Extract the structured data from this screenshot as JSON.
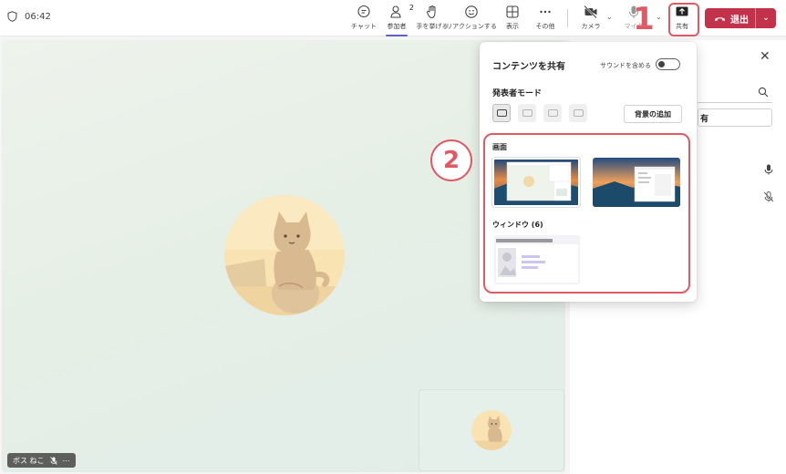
{
  "header": {
    "timer": "06:42",
    "buttons": {
      "chat": "チャット",
      "people": "参加者",
      "people_count": "2",
      "raise_hand": "手を挙げる",
      "reactions": "リアクションする",
      "view": "表示",
      "more": "その他",
      "camera": "カメラ",
      "mic": "マイク",
      "share": "共有"
    },
    "leave": "退出"
  },
  "annotations": {
    "step1": "1",
    "step2": "2",
    "color": "#e05a66"
  },
  "stage": {
    "participant_name": "ボス ねこ"
  },
  "right_panel": {
    "share_button_partial": "有"
  },
  "share_popup": {
    "title": "コンテンツを共有",
    "sound_label": "サウンドを含める",
    "presenter_mode_label": "発表者モード",
    "add_background": "背景の追加",
    "screen_section": "画面",
    "window_section": "ウィンドウ (6)"
  },
  "colors": {
    "accent": "#5b5fc7",
    "leave_red": "#c4314b"
  },
  "icons": [
    "shield-icon",
    "chat-icon",
    "people-icon",
    "hand-icon",
    "emoji-icon",
    "grid-icon",
    "more-icon",
    "camera-off-icon",
    "mic-icon",
    "share-icon",
    "phone-icon",
    "close-icon",
    "search-icon",
    "mic-muted-icon"
  ]
}
